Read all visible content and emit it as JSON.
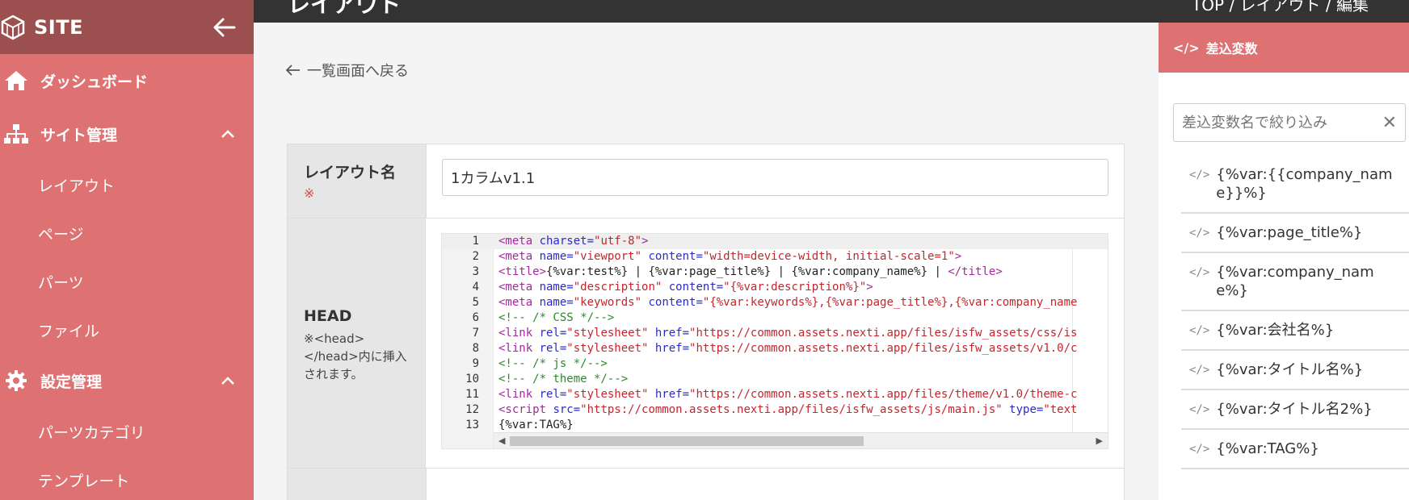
{
  "sidebar": {
    "title": "SITE",
    "sections": [
      {
        "label": "ダッシュボード",
        "items": []
      },
      {
        "label": "サイト管理",
        "items": [
          "レイアウト",
          "ページ",
          "パーツ",
          "ファイル"
        ]
      },
      {
        "label": "設定管理",
        "items": [
          "パーツカテゴリ",
          "テンプレート"
        ]
      }
    ]
  },
  "topbar": {
    "title": "レイアウト",
    "breadcrumb": "TOP / レイアウト / 編集"
  },
  "main": {
    "back_label": "一覧画面へ戻る",
    "form": {
      "name_label": "レイアウト名",
      "required_mark": "※",
      "name_value": "1カラムv1.1",
      "head_label": "HEAD",
      "head_note": "※<head></head>内に挿入されます。"
    },
    "editor": {
      "lines": [
        {
          "n": "1",
          "segs": [
            [
              "tag",
              "<meta "
            ],
            [
              "attr",
              "charset="
            ],
            [
              "str",
              "\"utf-8\""
            ],
            [
              "tag",
              ">"
            ]
          ]
        },
        {
          "n": "2",
          "segs": [
            [
              "tag",
              "<meta "
            ],
            [
              "attr",
              "name="
            ],
            [
              "str",
              "\"viewport\""
            ],
            [
              "attr",
              " content="
            ],
            [
              "str",
              "\"width=device-width, initial-scale=1\""
            ],
            [
              "tag",
              ">"
            ]
          ]
        },
        {
          "n": "3",
          "segs": [
            [
              "tag",
              "<title>"
            ],
            [
              "txt",
              "{%var:test%} | {%var:page_title%} | {%var:company_name%} | "
            ],
            [
              "tag",
              "</title>"
            ]
          ]
        },
        {
          "n": "4",
          "segs": [
            [
              "tag",
              "<meta "
            ],
            [
              "attr",
              "name="
            ],
            [
              "str",
              "\"description\""
            ],
            [
              "attr",
              " content="
            ],
            [
              "str",
              "\"{%var:description%}\""
            ],
            [
              "tag",
              ">"
            ]
          ]
        },
        {
          "n": "5",
          "segs": [
            [
              "tag",
              "<meta "
            ],
            [
              "attr",
              "name="
            ],
            [
              "str",
              "\"keywords\""
            ],
            [
              "attr",
              " content="
            ],
            [
              "str",
              "\"{%var:keywords%},{%var:page_title%},{%var:company_name"
            ]
          ]
        },
        {
          "n": "6",
          "segs": [
            [
              "com",
              "<!-- /* CSS */-->"
            ]
          ]
        },
        {
          "n": "7",
          "segs": [
            [
              "tag",
              "<link "
            ],
            [
              "attr",
              "rel="
            ],
            [
              "str",
              "\"stylesheet\""
            ],
            [
              "attr",
              " href="
            ],
            [
              "str",
              "\"https://common.assets.nexti.app/files/isfw_assets/css/is"
            ]
          ]
        },
        {
          "n": "8",
          "segs": [
            [
              "tag",
              "<link "
            ],
            [
              "attr",
              "rel="
            ],
            [
              "str",
              "\"stylesheet\""
            ],
            [
              "attr",
              " href="
            ],
            [
              "str",
              "\"https://common.assets.nexti.app/files/isfw_assets/v1.0/c"
            ]
          ]
        },
        {
          "n": "9",
          "segs": [
            [
              "com",
              "<!-- /* js */-->"
            ]
          ]
        },
        {
          "n": "10",
          "segs": [
            [
              "com",
              "<!-- /* theme */-->"
            ]
          ]
        },
        {
          "n": "11",
          "segs": [
            [
              "tag",
              "<link "
            ],
            [
              "attr",
              "rel="
            ],
            [
              "str",
              "\"stylesheet\""
            ],
            [
              "attr",
              " href="
            ],
            [
              "str",
              "\"https://common.assets.nexti.app/files/theme/v1.0/theme-c"
            ]
          ]
        },
        {
          "n": "12",
          "segs": [
            [
              "tag",
              "<script "
            ],
            [
              "attr",
              "src="
            ],
            [
              "str",
              "\"https://common.assets.nexti.app/files/isfw_assets/js/main.js\""
            ],
            [
              "attr",
              " type="
            ],
            [
              "str",
              "\"text"
            ]
          ]
        },
        {
          "n": "13",
          "segs": [
            [
              "txt",
              "{%var:TAG%}"
            ]
          ]
        }
      ]
    }
  },
  "rpanel": {
    "title": "差込変数",
    "search_placeholder": "差込変数名で絞り込み",
    "items": [
      "{%var:{{company_name}}%}",
      "{%var:page_title%}",
      "{%var:company_name%}",
      "{%var:会社名%}",
      "{%var:タイトル名%}",
      "{%var:タイトル名2%}",
      "{%var:TAG%}"
    ]
  }
}
